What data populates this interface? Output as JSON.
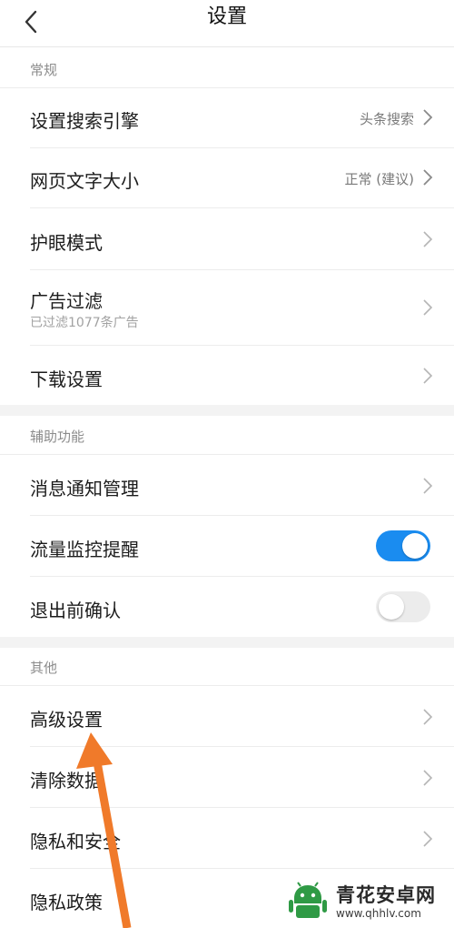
{
  "header": {
    "title": "设置"
  },
  "sections": {
    "general": "常规",
    "assist": "辅助功能",
    "other": "其他"
  },
  "rows": {
    "search_engine": {
      "label": "设置搜索引擎",
      "value": "头条搜索"
    },
    "font_size": {
      "label": "网页文字大小",
      "value": "正常 (建议)"
    },
    "eye_mode": {
      "label": "护眼模式"
    },
    "ad_filter": {
      "label": "广告过滤",
      "sub": "已过滤1077条广告"
    },
    "download": {
      "label": "下载设置"
    },
    "notify": {
      "label": "消息通知管理"
    },
    "traffic": {
      "label": "流量监控提醒",
      "toggle": true
    },
    "exit_confirm": {
      "label": "退出前确认",
      "toggle": false
    },
    "advanced": {
      "label": "高级设置"
    },
    "clear": {
      "label": "清除数据"
    },
    "privacy_security": {
      "label": "隐私和安全"
    },
    "privacy_policy": {
      "label": "隐私政策"
    }
  },
  "annotation": {
    "arrow_color": "#f07a2a"
  },
  "watermark": {
    "name": "青花安卓网",
    "url": "www.qhhlv.com"
  },
  "colors": {
    "accent": "#1a8cf0",
    "band": "#f3f3f3"
  }
}
